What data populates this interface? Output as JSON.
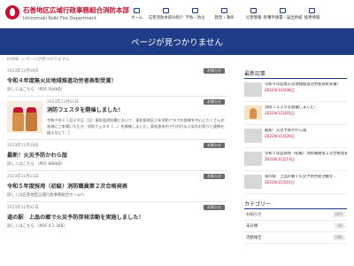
{
  "header": {
    "logo_title": "石巻地区広域行政事務組合消防本部",
    "logo_sub": "Ishinomaki Koiki Fire Department",
    "nav": [
      {
        "label": "ホーム",
        "icon": "home-icon"
      },
      {
        "label": "石巻消防本部の紹介",
        "icon": "info-icon"
      },
      {
        "label": "予防・防災",
        "icon": "shield-icon"
      },
      {
        "label": "救急・救命",
        "icon": "ambulance-icon"
      },
      {
        "label": "災害情報",
        "icon": "alert-icon"
      },
      {
        "label": "各種申請書・届出用紙",
        "icon": "document-icon"
      },
      {
        "label": "採用情報",
        "icon": "person-icon"
      }
    ]
  },
  "banner": {
    "title": "ページが見つかりません"
  },
  "breadcrumb": "HOME > ページが見つかりません",
  "posts": [
    {
      "date": "2023年12月08日",
      "category": "お知らせ",
      "title": "令和４年度無火災地域推進功労者表彰受賞！",
      "link": "詳しくはこちら （PDF 504KB）"
    },
    {
      "date": "2023年12月01日",
      "category": "お知らせ",
      "title": "消防フェスタを開催しました！",
      "excerpt": "令和４年１１月２９日（日）東松島消防署において、東松島地区少年消防クラブの皆様を中心にたくさんの皆様にご来場いただき、消防フェスタ（…）を開催しました。東松島市内で行われる人気のお祭りと連携を図るなど […]"
    },
    {
      "date": "2023年11月28日",
      "category": "お知らせ",
      "title": "最新！火災予防かわら版",
      "link": "詳しくはこちら （PDF 888KB）"
    },
    {
      "date": "2023年11月13日",
      "category": "お知らせ",
      "title": "令和５年度採用（初級）消防職員第２次合格発表",
      "link": "詳しくは石巻地区広域行政事務組合ホームへ"
    },
    {
      "date": "2023年11月01日",
      "category": "お知らせ",
      "title": "道の駅　上品の郷で火災予防啓発活動を実施しました！",
      "link": "詳しくはこちら （PDF 4 1 3KB）"
    }
  ],
  "sidebar": {
    "recent_heading": "最新記事",
    "recent": [
      {
        "title": "令和４年度無火災地域推進功労者表彰受賞！",
        "date": "2022年12月08日",
        "thumb": "plain"
      },
      {
        "title": "消防フェスタを開催しました！",
        "date": "2022年12月01日",
        "thumb": "fest"
      },
      {
        "title": "最新！火災予防かわら版",
        "date": "2022年11月28日",
        "thumb": "plain"
      },
      {
        "title": "令和５年度採用（初級）消防職員第２次合格発表",
        "date": "2022年11月13日",
        "thumb": "plain"
      },
      {
        "title": "道の駅　上品の郷で火災予防啓発活動を…",
        "date": "2022年11月01日",
        "thumb": "plain"
      }
    ],
    "category_heading": "カテゴリー",
    "categories": [
      {
        "label": "お知らせ",
        "count": "(47)"
      },
      {
        "label": "未分類",
        "count": "(3)"
      },
      {
        "label": "活動報告",
        "count": "(35)"
      }
    ]
  },
  "colors": {
    "brand_red": "#c8102e",
    "banner_navy": "#1f3c88"
  }
}
